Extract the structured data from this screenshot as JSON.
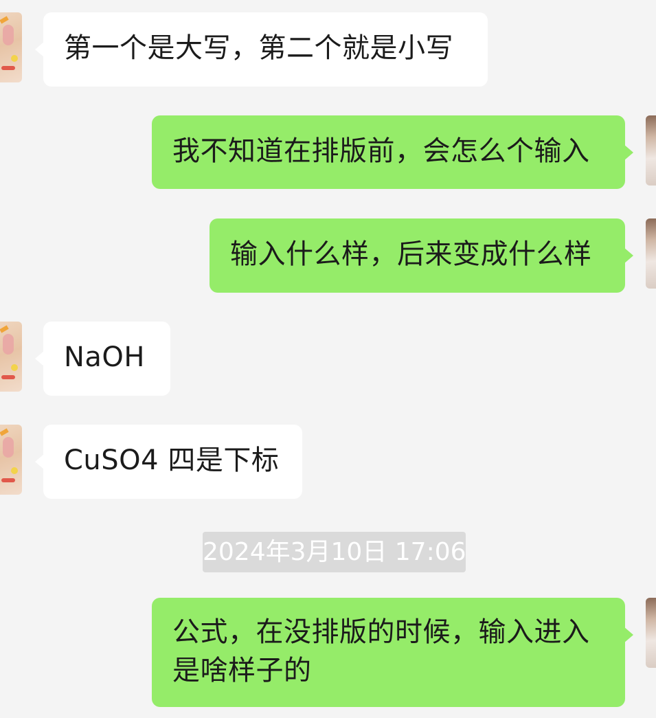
{
  "messages": [
    {
      "side": "in",
      "text": "第一个是大写，第二个就是小写"
    },
    {
      "side": "out",
      "text": "我不知道在排版前，会怎么个输入"
    },
    {
      "side": "out",
      "text": "输入什么样，后来变成什么样"
    },
    {
      "side": "in",
      "text": "NaOH"
    },
    {
      "side": "in",
      "text": "CuSO4 四是下标"
    },
    {
      "side": "out",
      "lines": [
        "公式，在没排版的时候，输入进入",
        "是啥样子的"
      ]
    }
  ],
  "timestamp": "2024年3月10日 17:06",
  "colors": {
    "background": "#f4f4f4",
    "incoming_bubble": "#ffffff",
    "outgoing_bubble": "#95ec69",
    "timestamp_bg": "#dadada",
    "timestamp_text": "#ffffff"
  },
  "icons": {
    "incoming_avatar": "contact-avatar",
    "outgoing_avatar": "self-avatar"
  }
}
